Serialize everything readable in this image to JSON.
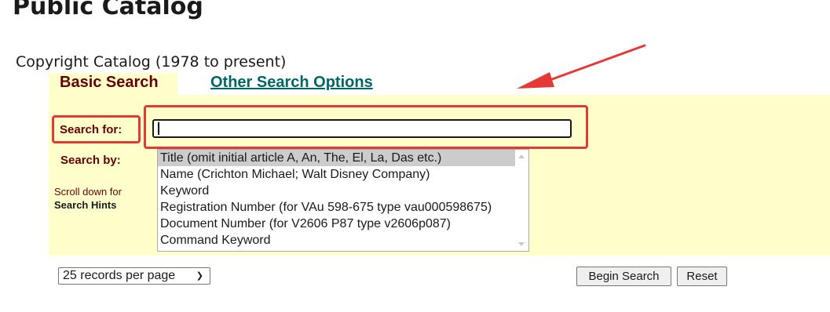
{
  "header": {
    "title": "Public Catalog",
    "subtitle": "Copyright Catalog (1978 to present)"
  },
  "tabs": {
    "basic_label": "Basic Search",
    "other_label": "Other Search Options"
  },
  "search": {
    "search_for_label": "Search for:",
    "input_value": "",
    "search_by_label": "Search by:",
    "hint_line1": "Scroll down for",
    "hint_line2": "Search Hints",
    "options": [
      "Title (omit initial article A, An, The, El, La, Das etc.)",
      "Name (Crichton Michael; Walt Disney Company)",
      "Keyword",
      "Registration Number (for VAu 598-675 type vau000598675)",
      "Document Number (for V2606 P87 type v2606p087)",
      "Command Keyword"
    ],
    "selected_index": 0
  },
  "footer": {
    "records_per_page": "25 records per page",
    "begin_search_label": "Begin Search",
    "reset_label": "Reset"
  },
  "colors": {
    "panel_bg": "#ffffcc",
    "label_color": "#660000",
    "link_color": "#006666",
    "annotation": "#e53935"
  },
  "icons": {
    "records_dropdown": "chevron-down-icon",
    "annotation_arrow": "red-arrow-icon"
  }
}
